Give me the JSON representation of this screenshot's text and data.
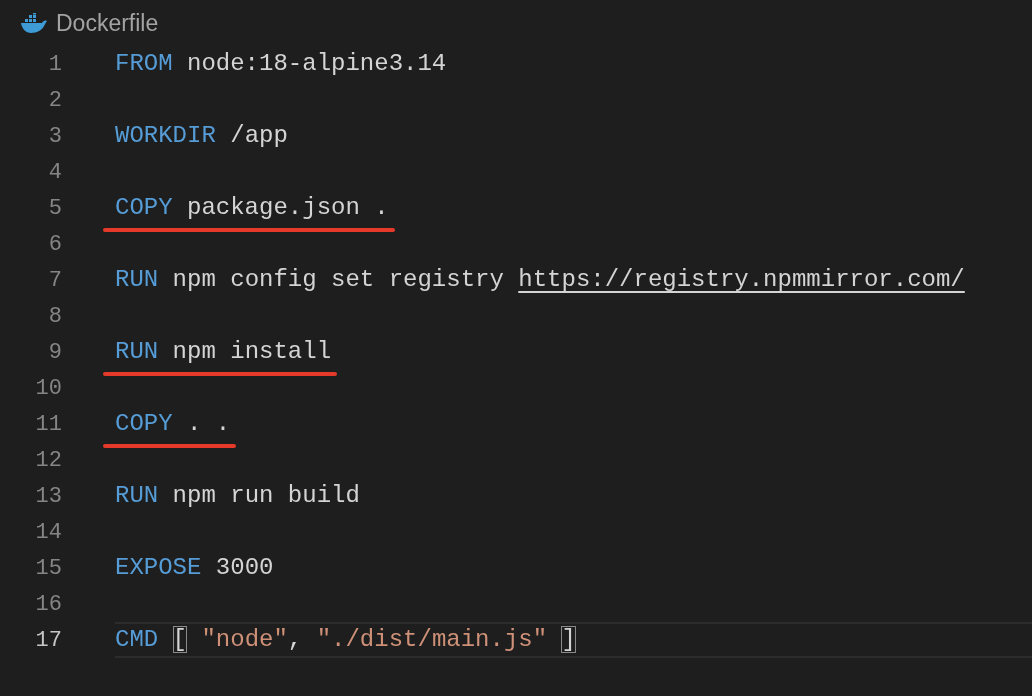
{
  "tab": {
    "title": "Dockerfile"
  },
  "lines": [
    {
      "number": "1",
      "current": false,
      "underlined": false,
      "tokens": [
        {
          "kind": "keyword",
          "text": "FROM"
        },
        {
          "kind": "plain",
          "text": " node:18-alpine3.14"
        }
      ]
    },
    {
      "number": "2",
      "current": false,
      "underlined": false
    },
    {
      "number": "3",
      "current": false,
      "underlined": false,
      "tokens": [
        {
          "kind": "keyword",
          "text": "WORKDIR"
        },
        {
          "kind": "plain",
          "text": " /app"
        }
      ]
    },
    {
      "number": "4",
      "current": false,
      "underlined": false
    },
    {
      "number": "5",
      "current": false,
      "underlined": true,
      "tokens": [
        {
          "kind": "keyword",
          "text": "COPY"
        },
        {
          "kind": "plain",
          "text": " package.json ."
        }
      ]
    },
    {
      "number": "6",
      "current": false,
      "underlined": false
    },
    {
      "number": "7",
      "current": false,
      "underlined": false,
      "tokens": [
        {
          "kind": "keyword",
          "text": "RUN"
        },
        {
          "kind": "plain",
          "text": " npm config set registry "
        },
        {
          "kind": "link",
          "text": "https://registry.npmmirror.com/"
        }
      ]
    },
    {
      "number": "8",
      "current": false,
      "underlined": false
    },
    {
      "number": "9",
      "current": false,
      "underlined": true,
      "tokens": [
        {
          "kind": "keyword",
          "text": "RUN"
        },
        {
          "kind": "plain",
          "text": " npm install"
        }
      ]
    },
    {
      "number": "10",
      "current": false,
      "underlined": false
    },
    {
      "number": "11",
      "current": false,
      "underlined": true,
      "tokens": [
        {
          "kind": "keyword",
          "text": "COPY"
        },
        {
          "kind": "plain",
          "text": " . ."
        }
      ]
    },
    {
      "number": "12",
      "current": false,
      "underlined": false
    },
    {
      "number": "13",
      "current": false,
      "underlined": false,
      "tokens": [
        {
          "kind": "keyword",
          "text": "RUN"
        },
        {
          "kind": "plain",
          "text": " npm run build"
        }
      ]
    },
    {
      "number": "14",
      "current": false,
      "underlined": false
    },
    {
      "number": "15",
      "current": false,
      "underlined": false,
      "tokens": [
        {
          "kind": "keyword",
          "text": "EXPOSE"
        },
        {
          "kind": "number",
          "text": " 3000"
        }
      ]
    },
    {
      "number": "16",
      "current": false,
      "underlined": false
    },
    {
      "number": "17",
      "current": true,
      "underlined": false,
      "tokens": [
        {
          "kind": "keyword",
          "text": "CMD"
        },
        {
          "kind": "bracket",
          "text": "["
        },
        {
          "kind": "string",
          "text": " \"node\""
        },
        {
          "kind": "plain",
          "text": ", "
        },
        {
          "kind": "string",
          "text": "\"./dist/main.js\""
        },
        {
          "kind": "bracket",
          "text": "]"
        }
      ]
    }
  ]
}
